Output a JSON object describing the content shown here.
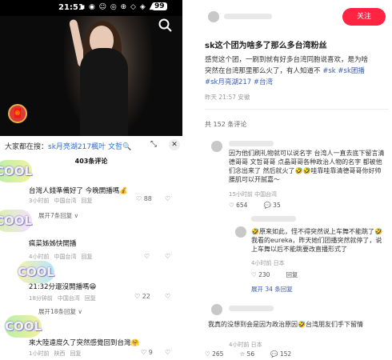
{
  "left": {
    "status": {
      "time": "21:51",
      "icons": "▪ ◉ ☺ ◎ ⊕ ◇ ◈ ▲ ◉",
      "battery": "99"
    },
    "search_icon": "search-icon",
    "red_packet_icon": "red-packet-icon",
    "sheet": {
      "searching_prefix": "大家都在搜：",
      "searching_query": "sk月亮湖217楓叶 文哲",
      "search_suffix": "🔍",
      "count": "403条评论",
      "collapse": "⤡",
      "close": "✕"
    },
    "comments": [
      {
        "sticker": "COOL",
        "text": "台灣人錢準備好了 今晚開播嗎💰",
        "time": "3小时前",
        "location": "中国台湾",
        "reply": "回复",
        "likes": "88"
      },
      {
        "expand": "展开7条回复 ∨"
      },
      {
        "sticker": "COOL",
        "text": "瘋菜姊姊快開播",
        "time": "4小时前",
        "location": "中国台湾",
        "reply": "回复",
        "likes": ""
      },
      {
        "sticker": "COOL",
        "text": "21:32分還沒開播嗎😁",
        "time": "18分钟前",
        "location": "中国台湾",
        "reply": "回复",
        "likes": "22"
      },
      {
        "expand": "展开18条回复 ∨"
      },
      {
        "sticker": "COOL",
        "text": "來大陸遠度久了突然感覺回到台灣🤗",
        "time": "1小时前",
        "location": "陕西",
        "reply": "回复",
        "likes": "9"
      }
    ]
  },
  "right": {
    "follow_label": "关注",
    "post": {
      "title": "sk这个团为啥多了那么多台湾粉丝",
      "body_line1": "感觉这个团，一刷到就有好多台湾同胞说喜欢，是为啥",
      "body_line2": "突然在台湾那里那么火了，有人知道不",
      "tags": [
        "#sk",
        "#sk团播",
        "#sk月亮湖217",
        "#台湾"
      ],
      "meta": "昨天 21:57 安徽"
    },
    "total": "共 152 条评论",
    "comments": [
      {
        "text": "因为他们刷礼物就可以说名字 台湾人一直去底下留言清德哥哥 文哲哥哥 点晶哥哥各种政治人物的名字 都被他们念出来了 然后就火了🤣🤣哇靠哇靠清德哥哥你好帅 腰肌可以开腻嘉～",
        "meta": "15小时前 中国台湾",
        "likes": "654",
        "replies": "35"
      },
      {
        "text": "🤣原来如此，怪不得突然说上车舞不能跳了🤣我看的eureka，昨天她们团播突然就停了，说上车舞以后不能跳要改直播形式了",
        "meta": "4小时前 日本",
        "likes": "230",
        "replies": "回复"
      },
      {
        "expand": "展开 34 条回复"
      },
      {
        "text": "我真的没想到会是因为政治原因🤣台湾朋友们手下留情",
        "meta": "4小时前 日本",
        "likes": "",
        "replies": ""
      }
    ],
    "bottom": {
      "likes": "265",
      "stars": "56",
      "comments": "152"
    }
  }
}
